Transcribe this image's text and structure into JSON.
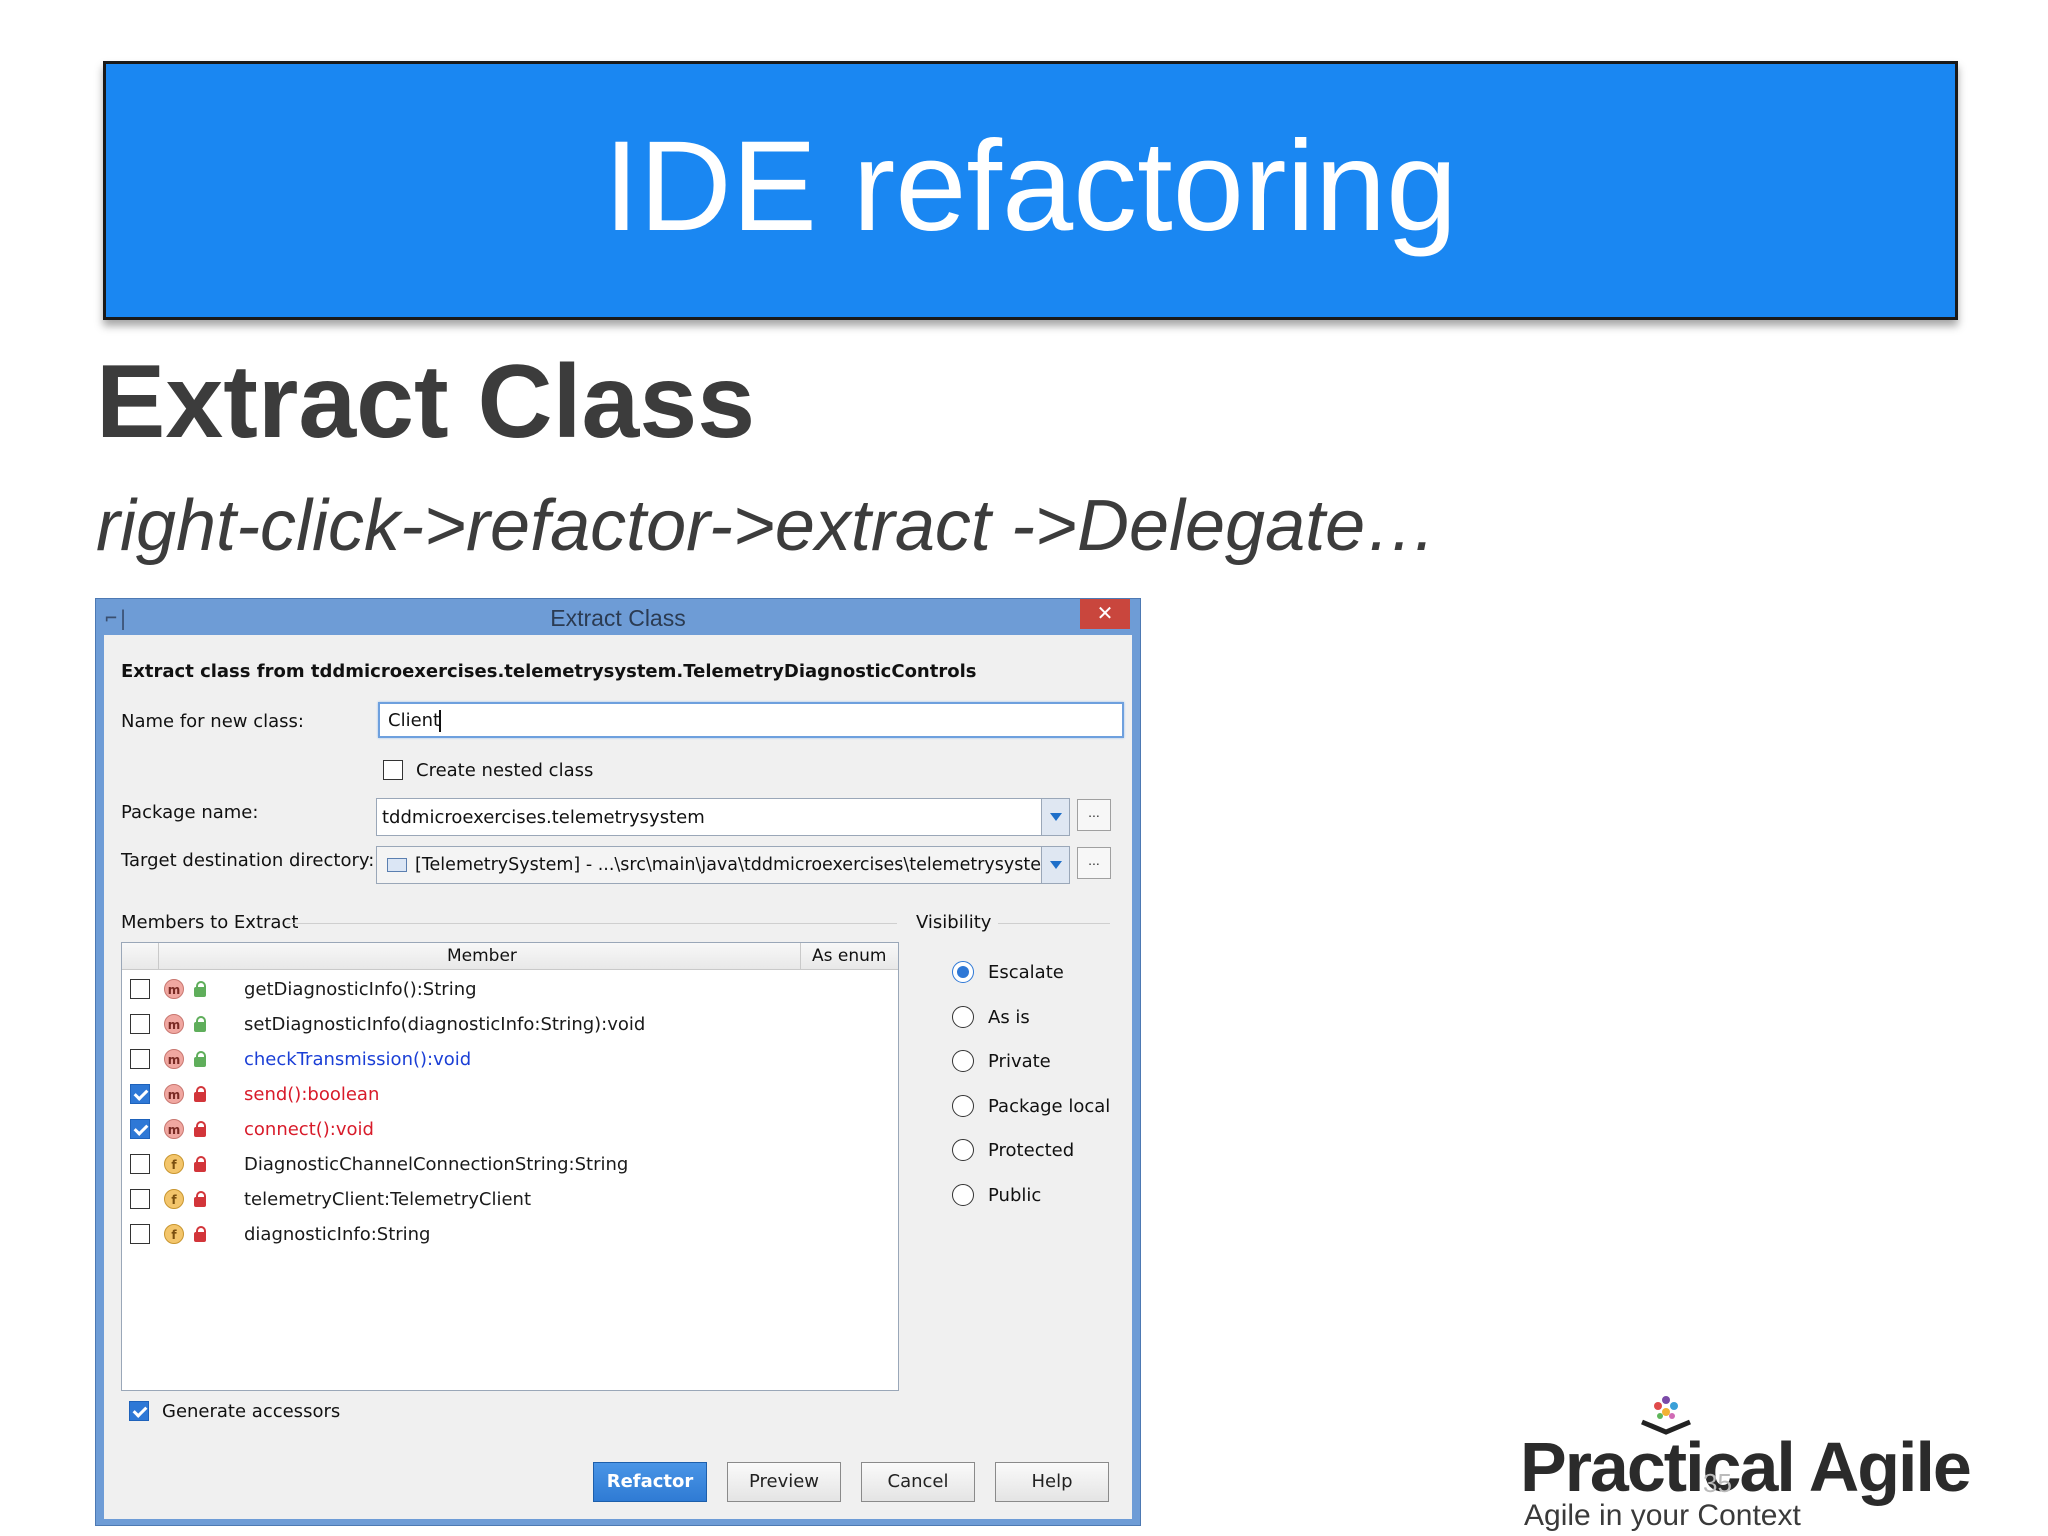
{
  "slide": {
    "banner_title": "IDE refactoring",
    "title": "Extract Class",
    "subtitle": "right-click->refactor->extract ->Delegate…",
    "page_number": "35"
  },
  "logo": {
    "name": "Practical Agile",
    "tagline": "Agile in your Context"
  },
  "dialog": {
    "title": "Extract Class",
    "close_label": "✕",
    "app_icon": "intellij-icon",
    "header": "Extract class from tddmicroexercises.telemetrysystem.TelemetryDiagnosticControls",
    "name_label": "Name for new class:",
    "name_value": "Client",
    "nested_label": "Create nested class",
    "nested_checked": false,
    "package_label": "Package name:",
    "package_value": "tddmicroexercises.telemetrysystem",
    "target_label": "Target destination directory:",
    "target_value": "[TelemetrySystem] - ...\\src\\main\\java\\tddmicroexercises\\telemetrysystem",
    "browse_label": "...",
    "members_label": "Members to Extract",
    "columns": [
      "Member",
      "As enum"
    ],
    "members": [
      {
        "kind": "m",
        "access": "public",
        "name": "getDiagnosticInfo():String",
        "checked": false,
        "color": "#1a1a1a"
      },
      {
        "kind": "m",
        "access": "public",
        "name": "setDiagnosticInfo(diagnosticInfo:String):void",
        "checked": false,
        "color": "#1a1a1a"
      },
      {
        "kind": "m",
        "access": "public",
        "name": "checkTransmission():void",
        "checked": false,
        "color": "#1b3fd6"
      },
      {
        "kind": "m",
        "access": "private",
        "name": "send():boolean",
        "checked": true,
        "color": "#d81b2a"
      },
      {
        "kind": "m",
        "access": "private",
        "name": "connect():void",
        "checked": true,
        "color": "#d81b2a"
      },
      {
        "kind": "f",
        "access": "private",
        "name": "DiagnosticChannelConnectionString:String",
        "checked": false,
        "color": "#1a1a1a"
      },
      {
        "kind": "f",
        "access": "private",
        "name": "telemetryClient:TelemetryClient",
        "checked": false,
        "color": "#1a1a1a"
      },
      {
        "kind": "f",
        "access": "private",
        "name": "diagnosticInfo:String",
        "checked": false,
        "color": "#1a1a1a"
      }
    ],
    "visibility_label": "Visibility",
    "visibility_options": [
      "Escalate",
      "As is",
      "Private",
      "Package local",
      "Protected",
      "Public"
    ],
    "visibility_selected": "Escalate",
    "generate_accessors_label": "Generate accessors",
    "generate_accessors_checked": true,
    "buttons": {
      "refactor": "Refactor",
      "preview": "Preview",
      "cancel": "Cancel",
      "help": "Help"
    },
    "colors": {
      "banner": "#1a87f2",
      "dialog_frame": "#6e9cd6",
      "primary_button": "#2f7bd4",
      "public_member": "#1b3fd6",
      "private_member": "#d81b2a"
    }
  }
}
